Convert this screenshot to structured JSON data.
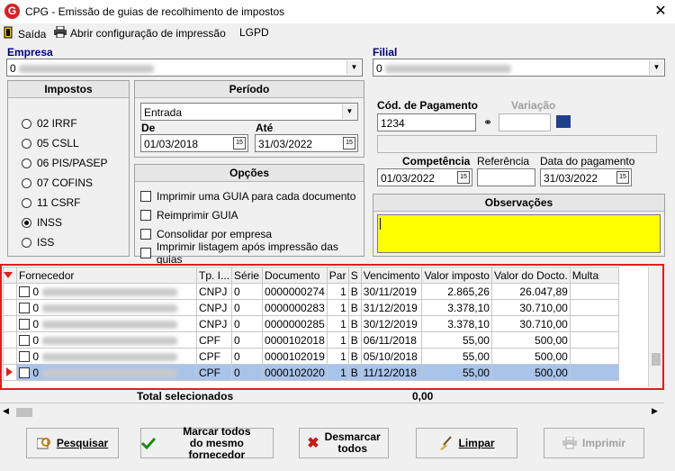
{
  "window": {
    "title": "CPG - Emissão de guias de recolhimento de impostos",
    "app_icon": "G"
  },
  "menu": {
    "exit": "Saída",
    "print_config": "Abrir configuração de impressão",
    "lgpd": "LGPD"
  },
  "empresa": {
    "label": "Empresa",
    "value": "0"
  },
  "filial": {
    "label": "Filial",
    "value": "0"
  },
  "impostos": {
    "title": "Impostos",
    "options": [
      {
        "label": "02 IRRF",
        "selected": false
      },
      {
        "label": "05 CSLL",
        "selected": false
      },
      {
        "label": "06 PIS/PASEP",
        "selected": false
      },
      {
        "label": "07 COFINS",
        "selected": false
      },
      {
        "label": "11 CSRF",
        "selected": false
      },
      {
        "label": "INSS",
        "selected": true
      },
      {
        "label": "ISS",
        "selected": false
      }
    ]
  },
  "periodo": {
    "title": "Período",
    "type": "Entrada",
    "de_label": "De",
    "de": "01/03/2018",
    "ate_label": "Até",
    "ate": "31/03/2022"
  },
  "opcoes": {
    "title": "Opções",
    "items": [
      "Imprimir uma GUIA para cada documento",
      "Reimprimir GUIA",
      "Consolidar por empresa",
      "Imprimir listagem após impressão das guias"
    ]
  },
  "pagamento": {
    "cod_label": "Cód. de Pagamento",
    "cod": "1234",
    "variacao_label": "Variação",
    "competencia_label": "Competência",
    "competencia": "01/03/2022",
    "referencia_label": "Referência",
    "data_pag_label": "Data do pagamento",
    "data_pag": "31/03/2022"
  },
  "observacoes": {
    "title": "Observações"
  },
  "grid": {
    "columns": [
      "Fornecedor",
      "Tp. I...",
      "Série",
      "Documento",
      "Par",
      "S",
      "Vencimento",
      "Valor imposto",
      "Valor do Docto.",
      "Multa"
    ],
    "rows": [
      {
        "forn": "0",
        "tp": "CNPJ",
        "serie": "0",
        "doc": "0000000274",
        "par": "1",
        "s": "B",
        "venc": "30/11/2019",
        "imposto": "2.865,26",
        "docto": "26.047,89"
      },
      {
        "forn": "0",
        "tp": "CNPJ",
        "serie": "0",
        "doc": "0000000283",
        "par": "1",
        "s": "B",
        "venc": "31/12/2019",
        "imposto": "3.378,10",
        "docto": "30.710,00"
      },
      {
        "forn": "0",
        "tp": "CNPJ",
        "serie": "0",
        "doc": "0000000285",
        "par": "1",
        "s": "B",
        "venc": "30/12/2019",
        "imposto": "3.378,10",
        "docto": "30.710,00"
      },
      {
        "forn": "0",
        "tp": "CPF",
        "serie": "0",
        "doc": "0000102018",
        "par": "1",
        "s": "B",
        "venc": "06/11/2018",
        "imposto": "55,00",
        "docto": "500,00"
      },
      {
        "forn": "0",
        "tp": "CPF",
        "serie": "0",
        "doc": "0000102019",
        "par": "1",
        "s": "B",
        "venc": "05/10/2018",
        "imposto": "55,00",
        "docto": "500,00"
      },
      {
        "forn": "0",
        "tp": "CPF",
        "serie": "0",
        "doc": "0000102020",
        "par": "1",
        "s": "B",
        "venc": "11/12/2018",
        "imposto": "55,00",
        "docto": "500,00"
      }
    ],
    "total_label": "Total selecionados",
    "total_value": "0,00"
  },
  "buttons": {
    "pesquisar": "Pesquisar",
    "marcar_1": "Marcar todos",
    "marcar_2": "do mesmo fornecedor",
    "desmarcar_1": "Desmarcar",
    "desmarcar_2": "todos",
    "limpar": "Limpar",
    "imprimir": "Imprimir"
  },
  "colors": {
    "accent_red": "#e31b1b",
    "label_blue": "#000080",
    "obs_yellow": "#ffff00",
    "selected_row": "#a9c4eb"
  }
}
